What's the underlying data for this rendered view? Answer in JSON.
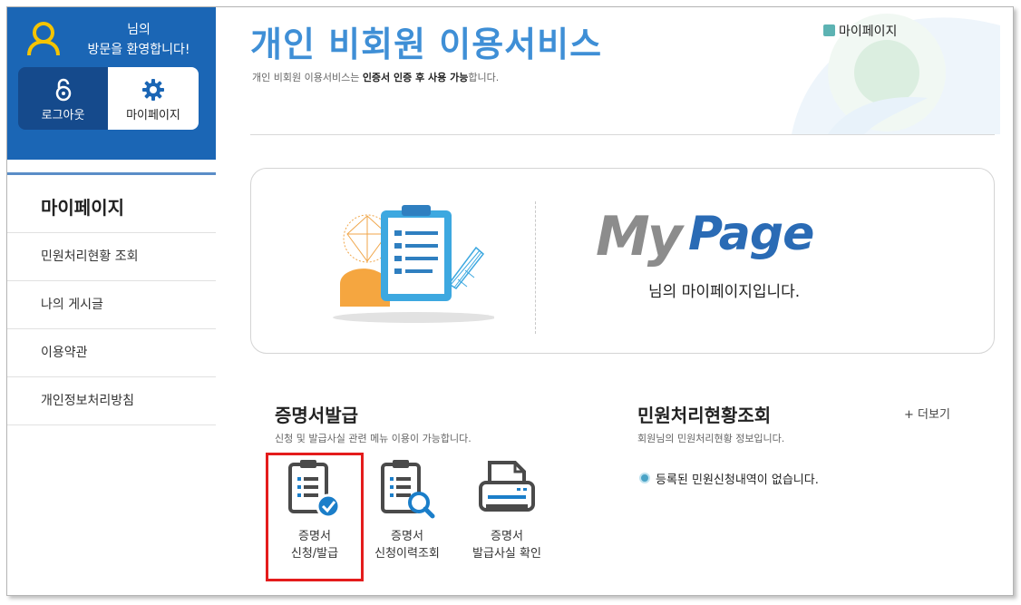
{
  "sidebar": {
    "welcome_line1": "님의",
    "welcome_line2": "방문을 환영합니다!",
    "logout_label": "로그아웃",
    "mypage_label": "마이페이지",
    "title": "마이페이지",
    "items": [
      {
        "label": "민원처리현황 조회"
      },
      {
        "label": "나의 게시글"
      },
      {
        "label": "이용약관"
      },
      {
        "label": "개인정보처리방침"
      }
    ]
  },
  "header": {
    "title": "개인 비회원 이용서비스",
    "subtitle_pre": "개인 비회원 이용서비스는 ",
    "subtitle_bold": "인증서 인증 후 사용 가능",
    "subtitle_post": "합니다.",
    "breadcrumb": "마이페이지"
  },
  "banner": {
    "my": "My",
    "page": "Page",
    "message": "님의 마이페이지입니다."
  },
  "cert_section": {
    "title": "증명서발급",
    "desc": "신청 및 발급사실 관련 메뉴 이용이 가능합니다.",
    "items": [
      {
        "line1": "증명서",
        "line2": "신청/발급",
        "icon": "clipboard-check-icon"
      },
      {
        "line1": "증명서",
        "line2": "신청이력조회",
        "icon": "clipboard-search-icon"
      },
      {
        "line1": "증명서",
        "line2": "발급사실 확인",
        "icon": "printer-icon"
      }
    ]
  },
  "status_section": {
    "title": "민원처리현황조회",
    "desc": "회원님의 민원처리현황 정보입니다.",
    "more": "+ 더보기",
    "empty_message": "등록된 민원신청내역이 없습니다."
  },
  "colors": {
    "sidebar_blue": "#1b66b5",
    "title_blue": "#3f8fd6",
    "highlight_red": "#e41c1c",
    "icon_accent": "#1b7ec9"
  }
}
